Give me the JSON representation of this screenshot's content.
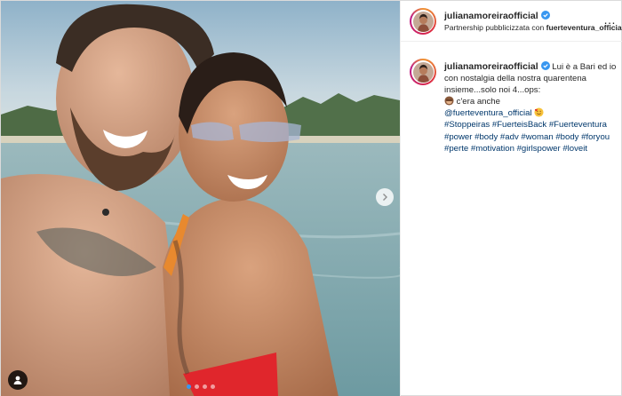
{
  "post": {
    "username": "julianamoreiraofficial",
    "partnership_prefix": "Partnership pubblicizzata con",
    "partner": "fuerteventura_official",
    "more_icon": "…"
  },
  "media": {
    "carousel_dots": 4,
    "active_dot": 1,
    "next_icon": "chevron-right-icon",
    "tag_icon": "person-tag-icon"
  },
  "caption": {
    "username": "julianamoreiraofficial",
    "text1": "Lui è a Bari ed io con nostalgia della nostra quarentena insieme...solo noi 4...ops:",
    "text2": "c'era anche",
    "mention": "@fuerteventura_official",
    "hashtags": "#Stoppeiras #FuerteisBack #Fuerteventura #power #body #adv #woman #body #foryou #perte #motivation #girlspower #loveit"
  },
  "colors": {
    "link": "#00376b",
    "verified": "#3897f0",
    "active_dot": "#3897f0"
  }
}
